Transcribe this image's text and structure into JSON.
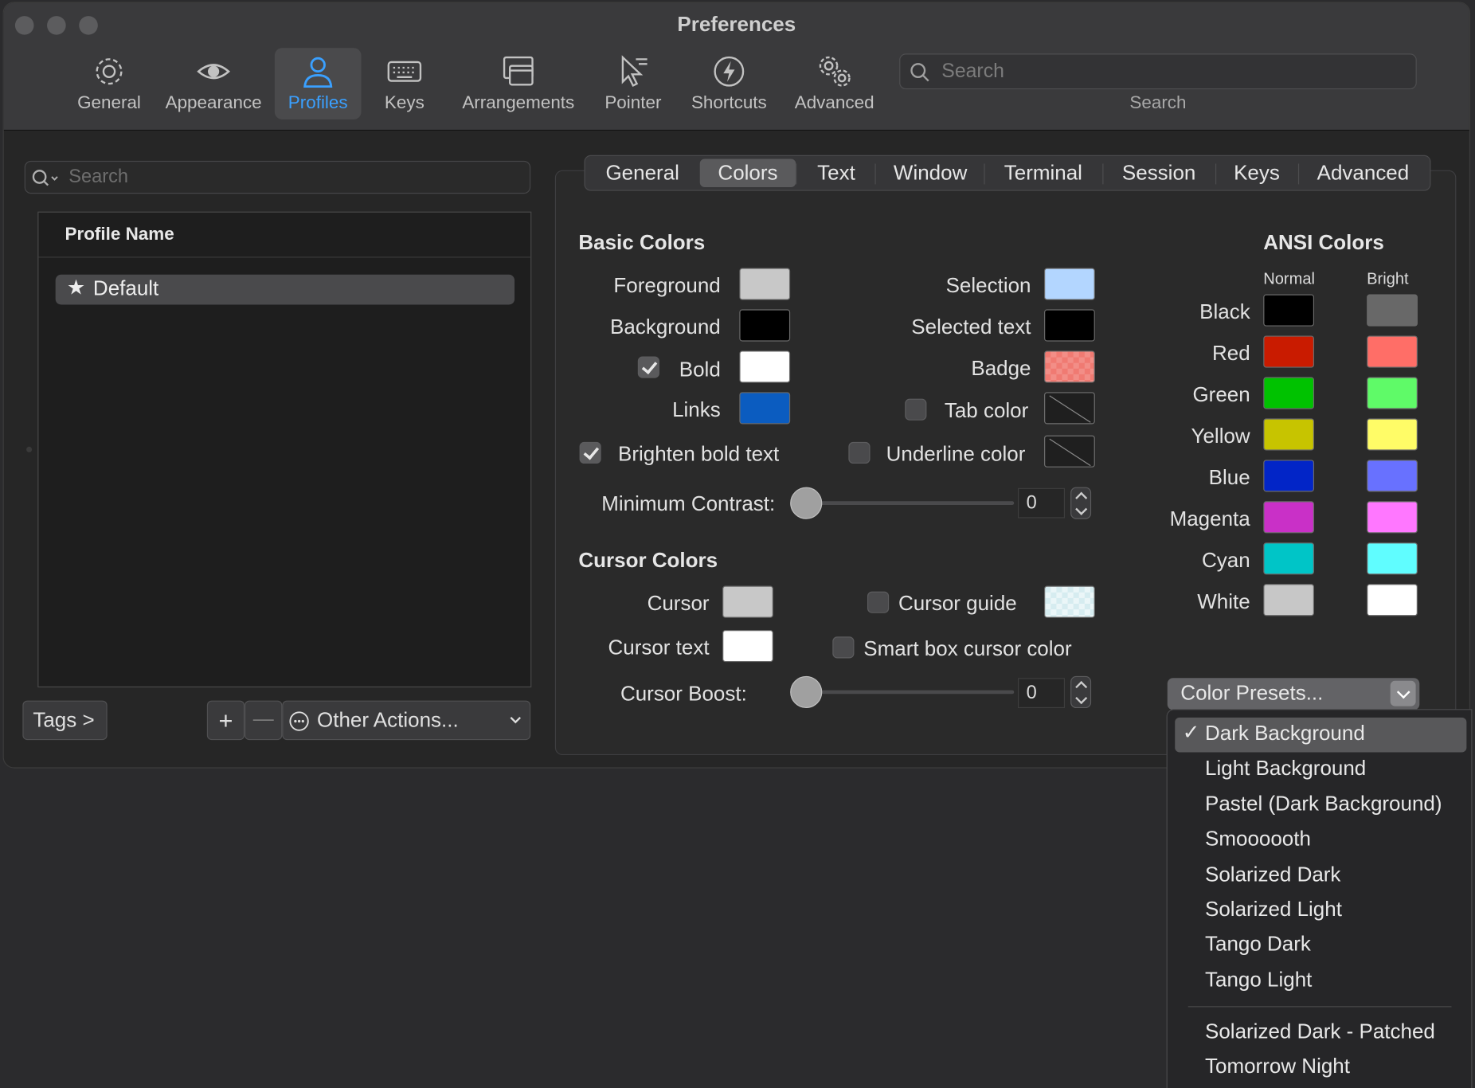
{
  "window": {
    "title": "Preferences"
  },
  "toolbar": {
    "items": [
      {
        "label": "General",
        "icon": "gear-icon"
      },
      {
        "label": "Appearance",
        "icon": "eye-icon"
      },
      {
        "label": "Profiles",
        "icon": "person-icon",
        "selected": true
      },
      {
        "label": "Keys",
        "icon": "keyboard-icon"
      },
      {
        "label": "Arrangements",
        "icon": "windows-icon"
      },
      {
        "label": "Pointer",
        "icon": "pointer-icon"
      },
      {
        "label": "Shortcuts",
        "icon": "lightning-icon"
      },
      {
        "label": "Advanced",
        "icon": "gears-icon"
      }
    ],
    "search_placeholder": "Search",
    "search_label": "Search"
  },
  "sidebar": {
    "search_placeholder": "Search",
    "column_header": "Profile Name",
    "profiles": [
      {
        "name": "Default",
        "star": "★"
      }
    ],
    "tags_button": "Tags >",
    "add_symbol": "+",
    "remove_symbol": "—",
    "other_actions": "Other Actions..."
  },
  "tabs": {
    "items": [
      "General",
      "Colors",
      "Text",
      "Window",
      "Terminal",
      "Session",
      "Keys",
      "Advanced"
    ],
    "selected": "Colors"
  },
  "basic_colors": {
    "heading": "Basic Colors",
    "foreground": {
      "label": "Foreground",
      "color": "#c8c8c8"
    },
    "background": {
      "label": "Background",
      "color": "#000000"
    },
    "bold": {
      "label": "Bold",
      "checked": true,
      "color": "#ffffff"
    },
    "links": {
      "label": "Links",
      "color": "#0b5cc0"
    },
    "selection": {
      "label": "Selection",
      "color": "#b3d6ff"
    },
    "selected_text": {
      "label": "Selected text",
      "color": "#000000"
    },
    "badge": {
      "label": "Badge",
      "color": "#f07a72"
    },
    "tab_color": {
      "label": "Tab color",
      "checked": false
    },
    "brighten_bold": {
      "label": "Brighten bold text",
      "checked": true
    },
    "underline_color": {
      "label": "Underline color",
      "checked": false
    },
    "min_contrast": {
      "label": "Minimum Contrast:",
      "value": "0"
    }
  },
  "cursor_colors": {
    "heading": "Cursor Colors",
    "cursor": {
      "label": "Cursor",
      "color": "#c8c8c8"
    },
    "cursor_text": {
      "label": "Cursor text",
      "color": "#ffffff"
    },
    "cursor_guide": {
      "label": "Cursor guide",
      "checked": false,
      "color": "#d6ecf0"
    },
    "smart_box": {
      "label": "Smart box cursor color",
      "checked": false
    },
    "cursor_boost": {
      "label": "Cursor Boost:",
      "value": "0"
    }
  },
  "ansi": {
    "heading": "ANSI Colors",
    "normal_label": "Normal",
    "bright_label": "Bright",
    "rows": [
      {
        "name": "Black",
        "normal": "#000000",
        "bright": "#686868"
      },
      {
        "name": "Red",
        "normal": "#c91b00",
        "bright": "#ff6e67"
      },
      {
        "name": "Green",
        "normal": "#00c200",
        "bright": "#5ffa68"
      },
      {
        "name": "Yellow",
        "normal": "#c7c400",
        "bright": "#fffc67"
      },
      {
        "name": "Blue",
        "normal": "#0225c7",
        "bright": "#6871ff"
      },
      {
        "name": "Magenta",
        "normal": "#c930c7",
        "bright": "#ff77ff"
      },
      {
        "name": "Cyan",
        "normal": "#00c5c7",
        "bright": "#60fdff"
      },
      {
        "name": "White",
        "normal": "#c7c7c7",
        "bright": "#ffffff"
      }
    ]
  },
  "presets": {
    "button_label": "Color Presets...",
    "checkmark": "✓",
    "items": [
      "Dark Background",
      "Light Background",
      "Pastel (Dark Background)",
      "Smoooooth",
      "Solarized Dark",
      "Solarized Light",
      "Tango Dark",
      "Tango Light"
    ],
    "custom_items": [
      "Solarized Dark - Patched",
      "Tomorrow Night"
    ],
    "selected": "Dark Background"
  }
}
